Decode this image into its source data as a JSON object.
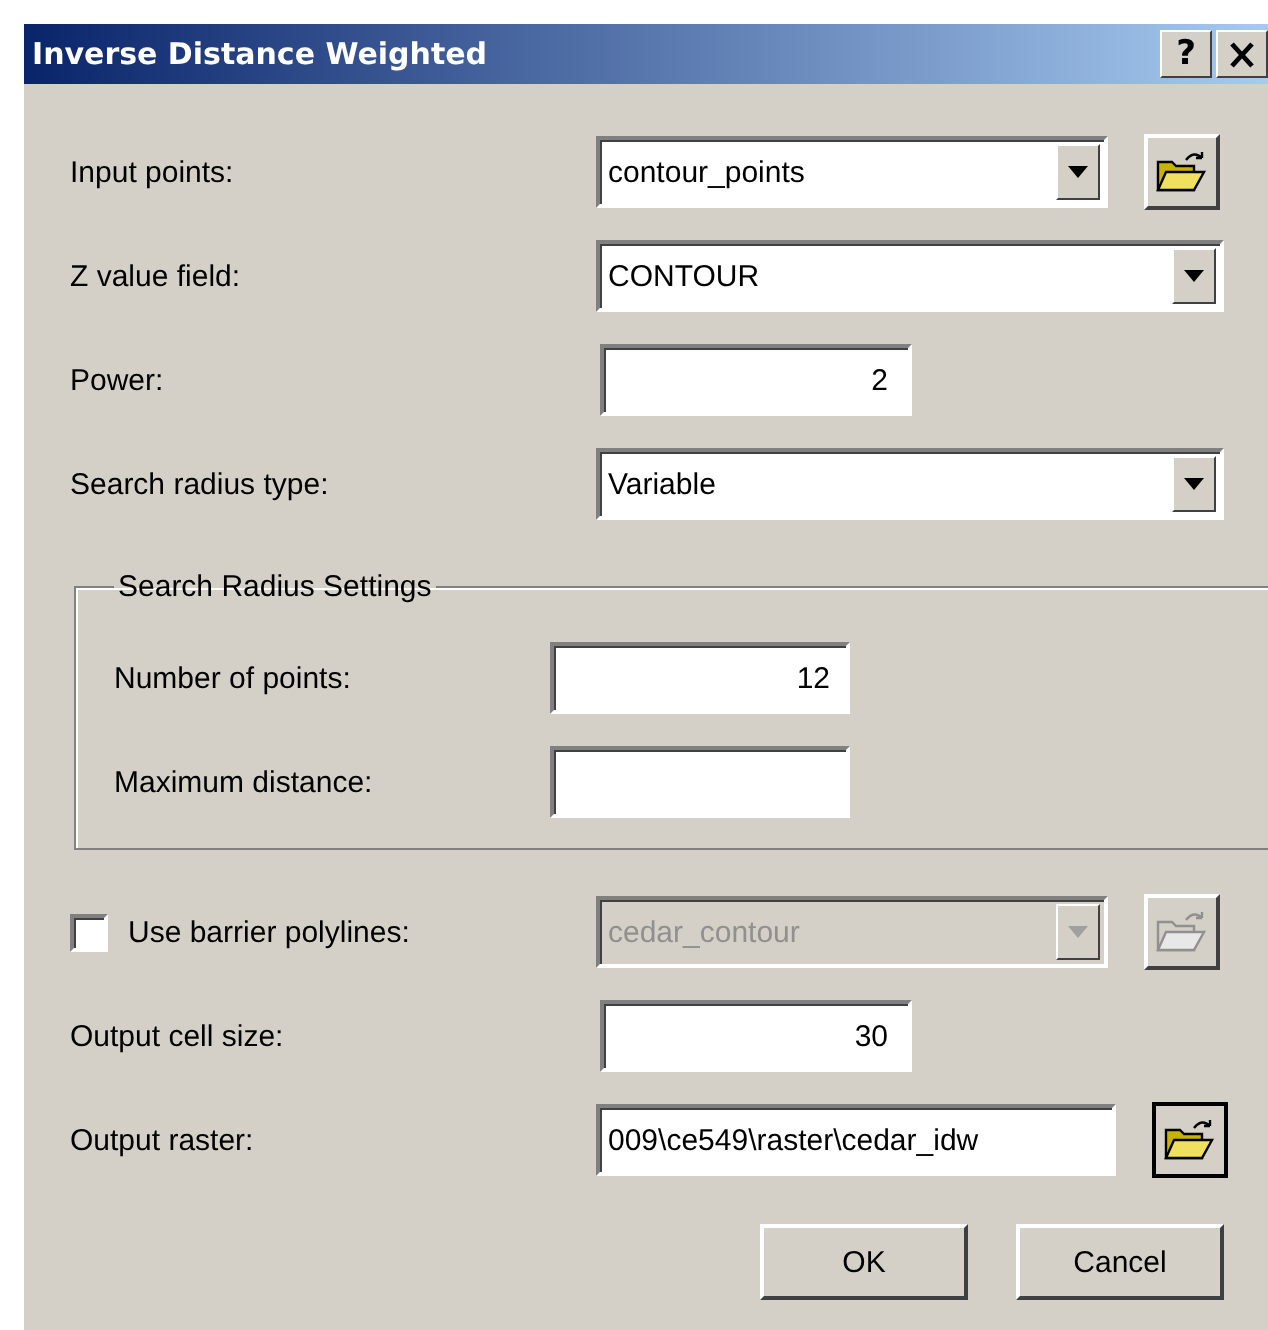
{
  "window": {
    "title": "Inverse Distance Weighted",
    "help_button": "?"
  },
  "fields": [
    {
      "kind": "combo",
      "label": "Input points:",
      "value": "contour_points",
      "browse": true,
      "disabled": false
    },
    {
      "kind": "combo",
      "label": "Z value field:",
      "value": "CONTOUR",
      "browse": false,
      "disabled": false
    },
    {
      "kind": "number",
      "label": "Power:",
      "value": "2",
      "browse": false,
      "disabled": false
    },
    {
      "kind": "combo",
      "label": "Search radius type:",
      "value": "Variable",
      "browse": false,
      "disabled": false
    }
  ],
  "group": {
    "title": "Search Radius Settings",
    "fields": [
      {
        "label": "Number of points:",
        "value": "12"
      },
      {
        "label": "Maximum distance:"
      }
    ]
  },
  "more_fields": [
    {
      "kind": "check-combo",
      "label": "Use barrier polylines:",
      "checked": false,
      "value": "cedar_contour",
      "browse": true,
      "disabled": true
    },
    {
      "kind": "number",
      "label": "Output cell size:",
      "value": "30",
      "browse": false,
      "disabled": false
    },
    {
      "kind": "path",
      "label": "Output raster:",
      "value": "009\\ce549\\raster\\cedar_idw",
      "browse": true,
      "disabled": false
    }
  ],
  "buttons": [
    "OK",
    "Cancel"
  ]
}
